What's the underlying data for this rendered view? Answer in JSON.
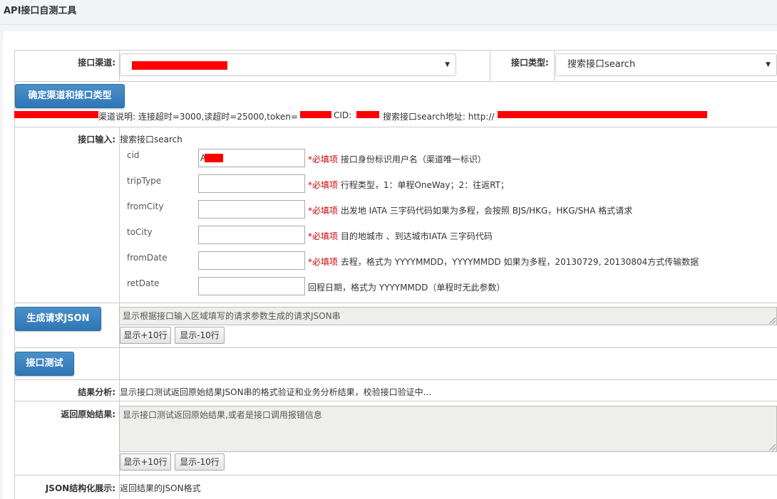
{
  "app": {
    "title": "API接口自测工具"
  },
  "channel": {
    "label": "接口渠道:",
    "selected": ""
  },
  "iface_type": {
    "label": "接口类型:",
    "selected": "搜索接口search"
  },
  "confirm_button": "确定渠道和接口类型",
  "channel_info": {
    "desc": "渠道说明: 连接超时=3000,读超时=25000,token=",
    "cid_label": "CID:",
    "search_addr": "搜索接口search地址: http://"
  },
  "input_section": {
    "label": "接口输入:",
    "interface_name": "搜索接口search",
    "params": [
      {
        "name": "cid",
        "value": "A",
        "required": "*必填项",
        "desc": "接口身份标识用户名（渠道唯一标识）"
      },
      {
        "name": "tripType",
        "value": "",
        "required": "*必填项",
        "desc": "行程类型，1：单程OneWay；2：往返RT；"
      },
      {
        "name": "fromCity",
        "value": "",
        "required": "*必填项",
        "desc": "出发地 IATA 三字码代码如果为多程，会按照 BJS/HKG，HKG/SHA 格式请求"
      },
      {
        "name": "toCity",
        "value": "",
        "required": "*必填项",
        "desc": "目的地城市 、到达城市IATA 三字码代码"
      },
      {
        "name": "fromDate",
        "value": "",
        "required": "*必填项",
        "desc": "去程，格式为 YYYYMMDD，YYYYMMDD 如果为多程，20130729, 20130804方式传输数据"
      },
      {
        "name": "retDate",
        "value": "",
        "required": "",
        "desc": "回程日期，格式为 YYYYMMDD（单程时无此参数）"
      }
    ]
  },
  "gen_json_button": "生成请求JSON",
  "request_json": {
    "placeholder": "显示根据接口输入区域填写的请求参数生成的请求JSON串"
  },
  "show_more": "显示+10行",
  "show_less": "显示-10行",
  "test_button": "接口测试",
  "analysis": {
    "label": "结果分析:",
    "text": "显示接口测试返回原始结果JSON串的格式验证和业务分析结果，校验接口验证中..."
  },
  "raw_result": {
    "label": "返回原始结果:",
    "placeholder": "显示接口测试返回原始结果,或者是接口调用报错信息"
  },
  "json_view": {
    "label": "JSON结构化展示:",
    "text": "返回结果的JSON格式"
  },
  "colors": {
    "primary_button": "#337ab7",
    "required": "#cc0000",
    "redaction": "#ff0000"
  }
}
